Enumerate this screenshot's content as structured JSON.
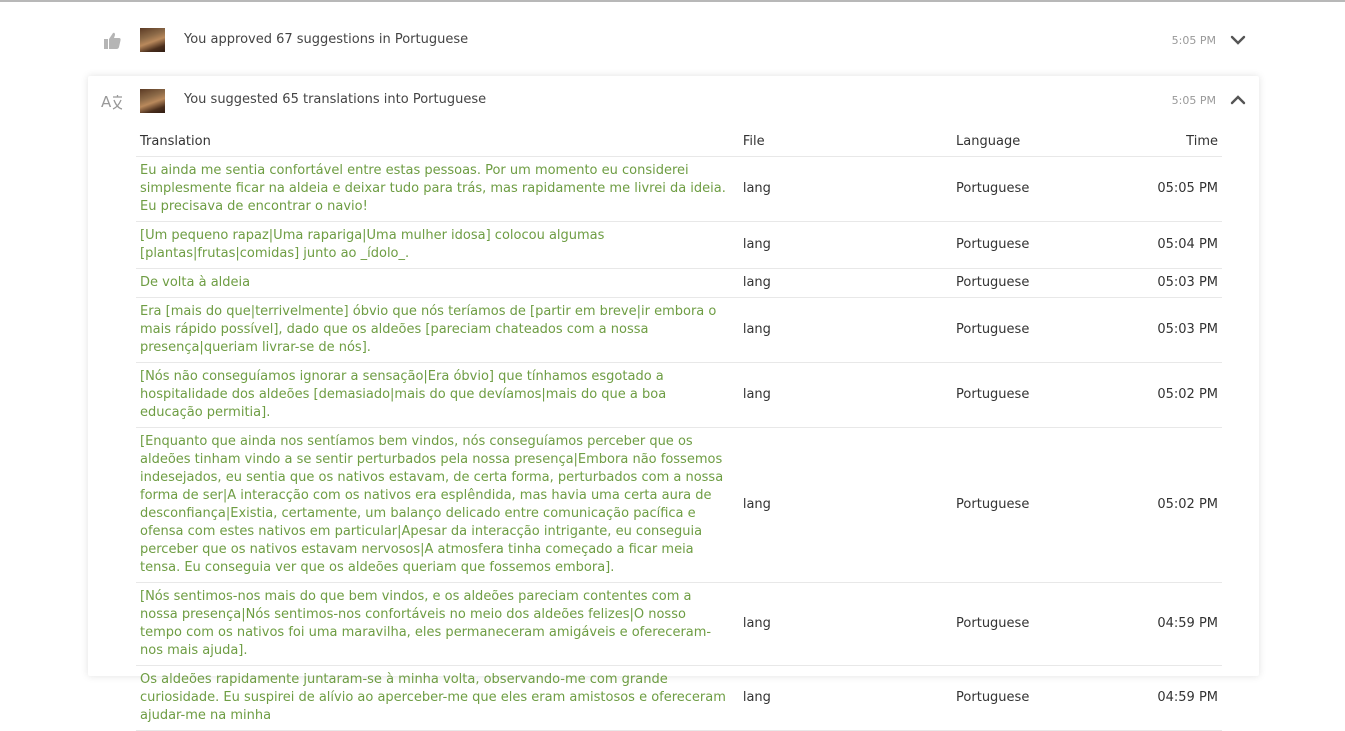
{
  "activities": [
    {
      "icon": "thumbs-up-icon",
      "text": "You approved 67 suggestions in Portuguese",
      "time": "5:05 PM",
      "toggle": "chevron-down-icon"
    },
    {
      "icon": "translate-icon",
      "text": "You suggested 65 translations into Portuguese",
      "time": "5:05 PM",
      "toggle": "chevron-up-icon"
    }
  ],
  "table": {
    "headers": {
      "translation": "Translation",
      "file": "File",
      "language": "Language",
      "time": "Time"
    },
    "rows": [
      {
        "translation": "Eu ainda me sentia confortável entre estas pessoas. Por um momento eu considerei simplesmente ficar na aldeia e deixar tudo para trás, mas rapidamente me livrei da ideia. Eu precisava de encontrar o navio!",
        "file": "lang",
        "language": "Portuguese",
        "time": "05:05 PM"
      },
      {
        "translation": "[Um pequeno rapaz|Uma rapariga|Uma mulher idosa] colocou algumas [plantas|frutas|comidas] junto ao _ídolo_.",
        "file": "lang",
        "language": "Portuguese",
        "time": "05:04 PM"
      },
      {
        "translation": "De volta à aldeia",
        "file": "lang",
        "language": "Portuguese",
        "time": "05:03 PM"
      },
      {
        "translation": "Era [mais do que|terrivelmente] óbvio que nós teríamos de [partir em breve|ir embora o mais rápido possível], dado que os aldeões [pareciam chateados com a nossa presença|queriam livrar-se de nós].",
        "file": "lang",
        "language": "Portuguese",
        "time": "05:03 PM"
      },
      {
        "translation": "[Nós não conseguíamos ignorar a sensação|Era óbvio] que tínhamos esgotado a hospitalidade dos aldeões [demasiado|mais do que devíamos|mais do que a boa educação permitia].",
        "file": "lang",
        "language": "Portuguese",
        "time": "05:02 PM"
      },
      {
        "translation": "[Enquanto que ainda nos sentíamos bem vindos, nós conseguíamos perceber que os aldeões tinham vindo a se sentir perturbados pela nossa presença|Embora não fossemos indesejados, eu sentia que os nativos estavam, de certa forma, perturbados com a nossa forma de ser|A interacção com os nativos era esplêndida, mas havia uma certa aura de desconfiança|Existia, certamente, um balanço delicado entre comunicação pacífica e ofensa com estes nativos em particular|Apesar da interacção intrigante, eu conseguia perceber que os nativos estavam nervosos|A atmosfera tinha começado a ficar meia tensa. Eu conseguia ver que os aldeões queriam que fossemos embora].",
        "file": "lang",
        "language": "Portuguese",
        "time": "05:02 PM"
      },
      {
        "translation": "[Nós sentimos-nos mais do que bem vindos, e os aldeões pareciam contentes com a nossa presença|Nós sentimos-nos confortáveis no meio dos aldeões felizes|O nosso tempo com os nativos foi uma maravilha, eles permaneceram amigáveis e ofereceram-nos mais ajuda].",
        "file": "lang",
        "language": "Portuguese",
        "time": "04:59 PM"
      },
      {
        "translation": "Os aldeões rapidamente juntaram-se à minha volta, observando-me com grande curiosidade. Eu suspirei de alívio ao aperceber-me que eles eram amistosos e ofereceram ajudar-me na minha",
        "file": "lang",
        "language": "Portuguese",
        "time": "04:59 PM"
      }
    ]
  }
}
